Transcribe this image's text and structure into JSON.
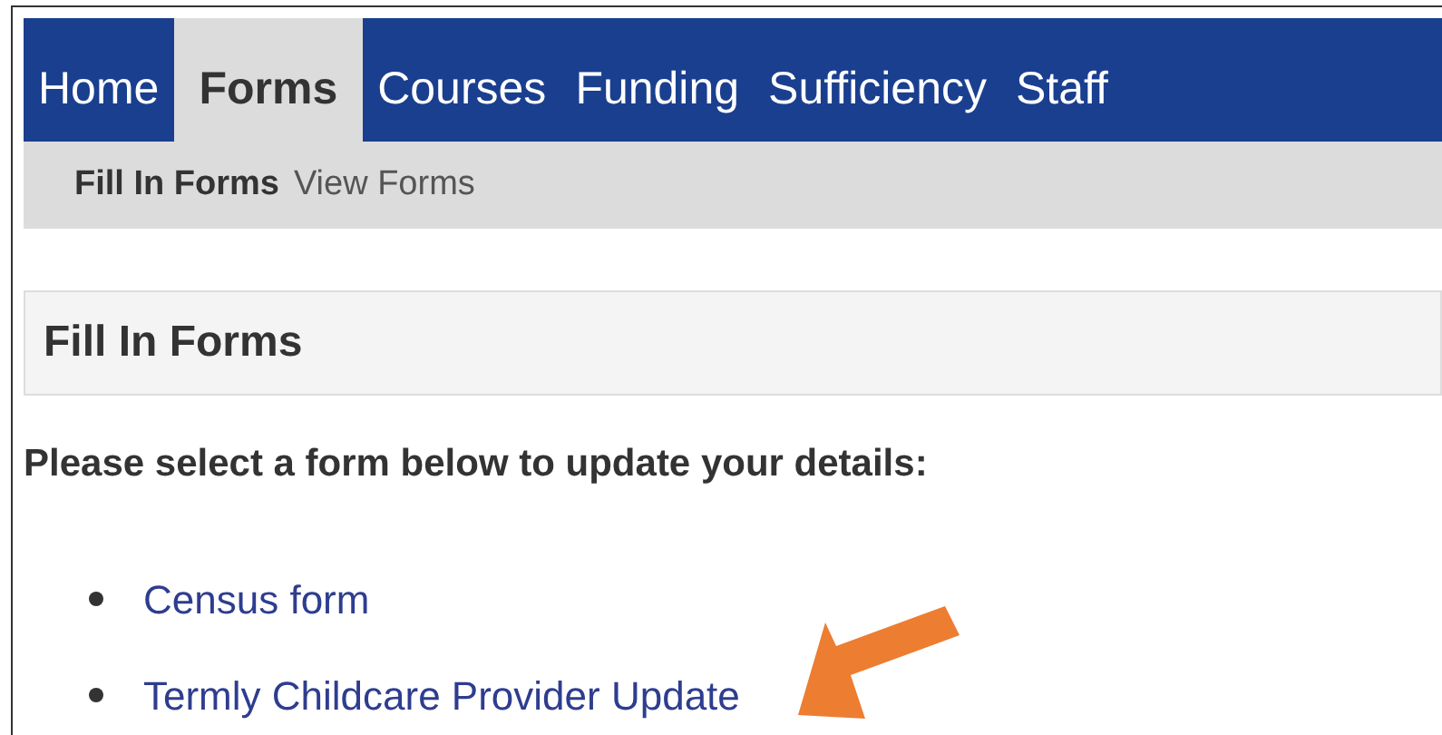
{
  "nav": {
    "tabs": [
      {
        "label": "Home",
        "selected": false
      },
      {
        "label": "Forms",
        "selected": true
      },
      {
        "label": "Courses",
        "selected": false
      },
      {
        "label": "Funding",
        "selected": false
      },
      {
        "label": "Sufficiency",
        "selected": false
      },
      {
        "label": "Staff",
        "selected": false
      }
    ]
  },
  "subnav": {
    "items": [
      {
        "label": "Fill In Forms",
        "selected": true
      },
      {
        "label": "View Forms",
        "selected": false
      }
    ]
  },
  "section": {
    "title": "Fill In Forms"
  },
  "intro": "Please select a form below to update your details:",
  "forms": [
    {
      "label": "Census form",
      "highlighted": false
    },
    {
      "label": "Termly Childcare Provider Update",
      "highlighted": true
    }
  ]
}
